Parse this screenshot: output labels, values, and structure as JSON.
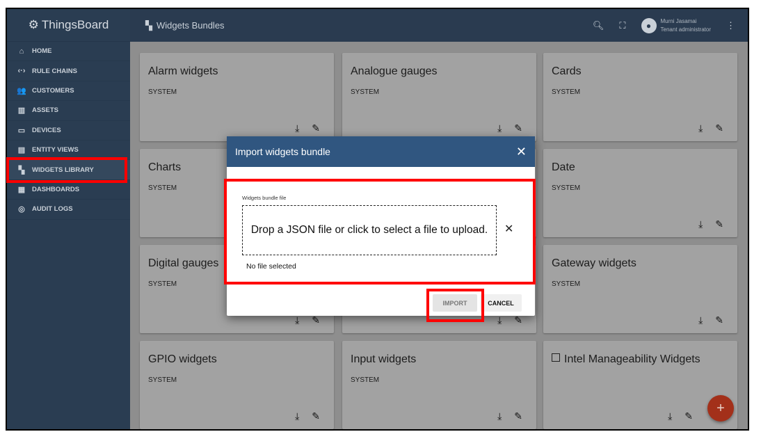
{
  "app": {
    "name": "ThingsBoard"
  },
  "sidebar": {
    "items": [
      {
        "label": "HOME",
        "icon": "home-icon"
      },
      {
        "label": "RULE CHAINS",
        "icon": "rule-chains-icon"
      },
      {
        "label": "CUSTOMERS",
        "icon": "customers-icon"
      },
      {
        "label": "ASSETS",
        "icon": "assets-icon"
      },
      {
        "label": "DEVICES",
        "icon": "devices-icon"
      },
      {
        "label": "ENTITY VIEWS",
        "icon": "entity-views-icon"
      },
      {
        "label": "WIDGETS LIBRARY",
        "icon": "widgets-icon",
        "active": true
      },
      {
        "label": "DASHBOARDS",
        "icon": "dashboards-icon"
      },
      {
        "label": "AUDIT LOGS",
        "icon": "audit-logs-icon"
      }
    ]
  },
  "header": {
    "title": "Widgets Bundles",
    "user_name": "Murni Jasamai",
    "user_role": "Tenant administrator"
  },
  "cards": [
    {
      "title": "Alarm widgets",
      "subtitle": "SYSTEM"
    },
    {
      "title": "Analogue gauges",
      "subtitle": "SYSTEM"
    },
    {
      "title": "Cards",
      "subtitle": "SYSTEM"
    },
    {
      "title": "Charts",
      "subtitle": "SYSTEM"
    },
    {
      "title": "Date",
      "subtitle": "SYSTEM"
    },
    {
      "title": "Digital gauges",
      "subtitle": "SYSTEM"
    },
    {
      "title": "Gateway widgets",
      "subtitle": "SYSTEM"
    },
    {
      "title": "GPIO widgets",
      "subtitle": "SYSTEM"
    },
    {
      "title": "Input widgets",
      "subtitle": "SYSTEM"
    },
    {
      "title": "Intel Manageability Widgets"
    }
  ],
  "dialog": {
    "title": "Import widgets bundle",
    "file_label": "Widgets bundle file",
    "drop_text": "Drop a JSON file or click to select a file to upload.",
    "no_file": "No file selected",
    "import_label": "IMPORT",
    "cancel_label": "CANCEL"
  },
  "fab_label": "+",
  "colors": {
    "header": "#305680",
    "highlight": "#ff0000",
    "fab": "#a3301a"
  }
}
